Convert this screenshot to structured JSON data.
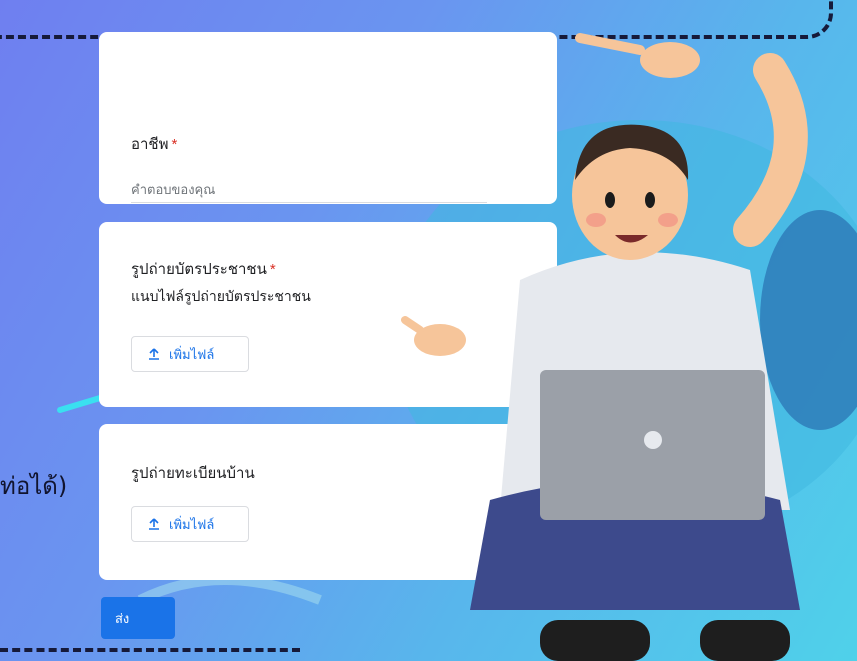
{
  "background": {
    "cut_text": "ท่อได้)",
    "gradient_colors": [
      "#6f7ff0",
      "#58b6ec",
      "#4fd1ea"
    ]
  },
  "form": {
    "occupation": {
      "title": "อาชีพ",
      "required_mark": "*",
      "placeholder": "คำตอบของคุณ"
    },
    "id_card_photo": {
      "title": "รูปถ่ายบัตรประชาชน",
      "required_mark": "*",
      "description": "แนบไฟล์รูปถ่ายบัตรประชาชน",
      "add_file_label": "เพิ่มไฟล์"
    },
    "house_registration_photo": {
      "title": "รูปถ่ายทะเบียนบ้าน",
      "add_file_label": "เพิ่มไฟล์"
    },
    "submit_label": "ส่ง",
    "accent_color": "#1a73e8",
    "required_color": "#d93025"
  },
  "illustration": {
    "subject": "man-with-laptop-pointing",
    "icon": "person-illustration-icon"
  }
}
